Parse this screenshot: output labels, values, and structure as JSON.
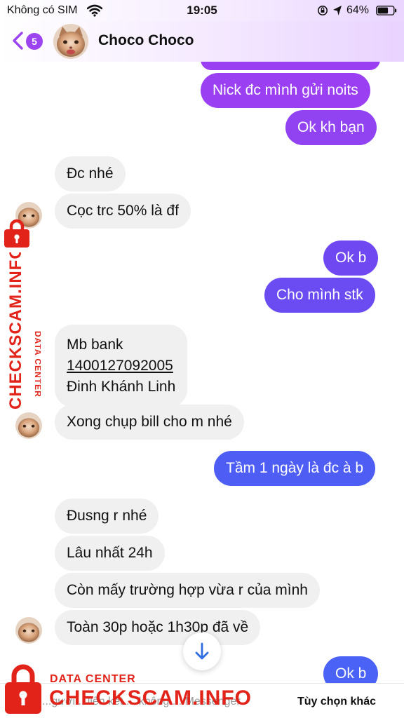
{
  "status_bar": {
    "carrier": "Không có SIM",
    "time": "19:05",
    "battery": "64%"
  },
  "header": {
    "back_count": "5",
    "contact_name": "Choco Choco"
  },
  "messages": [
    {
      "from": "me",
      "text": "Nick đc mình gửi noits"
    },
    {
      "from": "me",
      "text": "Ok kh bạn"
    },
    {
      "from": "them",
      "text": "Đc nhé"
    },
    {
      "from": "them",
      "text": "Cọc trc 50% là đf"
    },
    {
      "from": "me",
      "text": "Ok b"
    },
    {
      "from": "me",
      "text": "Cho mình stk"
    },
    {
      "from": "them",
      "lines": [
        "Mb bank",
        "1400127092005",
        "Đinh Khánh Linh"
      ]
    },
    {
      "from": "them",
      "text": "Xong chụp bill cho m nhé"
    },
    {
      "from": "me",
      "text": "Tầm 1 ngày là đc à b"
    },
    {
      "from": "them",
      "text": "Đusng r nhé"
    },
    {
      "from": "them",
      "text": "Lâu nhất 24h"
    },
    {
      "from": "them",
      "text": "Còn mấy trường hợp vừa r của mình"
    },
    {
      "from": "them",
      "text": "Toàn 30p hoặc 1h30p đã về"
    },
    {
      "from": "me",
      "text": "Ok b"
    }
  ],
  "bottom_bar": {
    "notice": "...gười... liên kết ... không ... Messenger.",
    "more_options": "Tùy chọn khác"
  },
  "watermark": {
    "side_small": "DATA CENTER",
    "side_big": "CHECKSCAM.INFO",
    "bottom_small": "DATA CENTER",
    "bottom_big": "CHECKSCAM.INFO"
  },
  "colors": {
    "accent_purple": "#9b44f0",
    "bubble_purple": "#8b3ff0",
    "bubble_violet": "#6a4cf2",
    "bubble_blue": "#4e5ef5",
    "incoming_bg": "#f0f0f0",
    "watermark_red": "#e2231a"
  },
  "icons": [
    "wifi-icon",
    "orientation-lock-icon",
    "location-arrow-icon",
    "battery-icon",
    "back-chevron-icon",
    "arrow-down-icon",
    "padlock-icon"
  ]
}
